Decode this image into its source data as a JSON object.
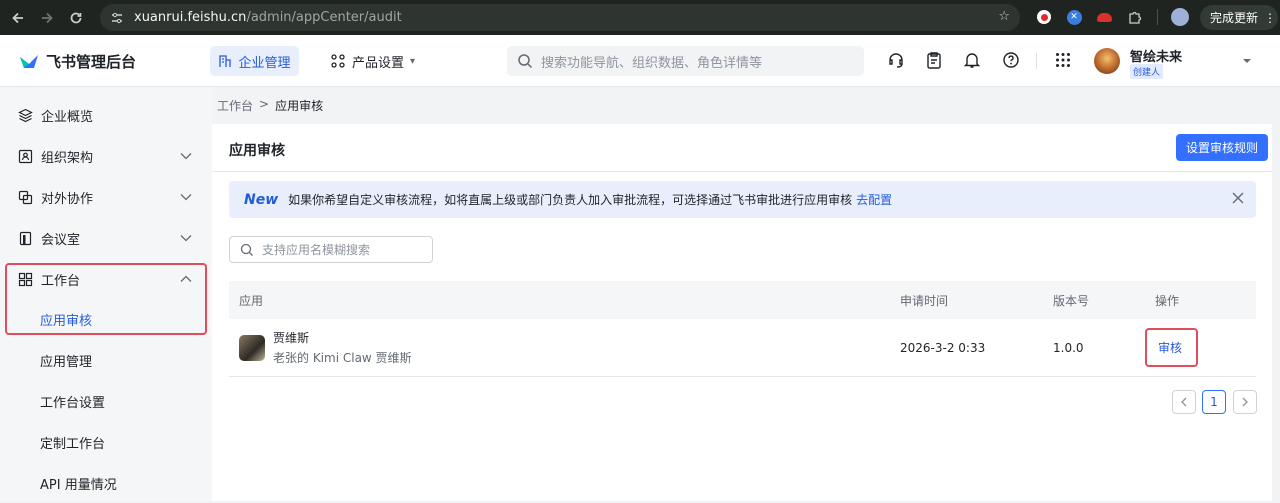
{
  "browser": {
    "url_host": "xuanrui.feishu.cn",
    "url_path": "/admin/appCenter/audit",
    "update_label": "完成更新"
  },
  "header": {
    "logo_text": "飞书管理后台",
    "tab_enterprise": "企业管理",
    "tab_product": "产品设置",
    "search_placeholder": "搜索功能导航、组织数据、角色详情等",
    "user_name": "智绘未来",
    "user_badge": "创建人"
  },
  "sidebar": {
    "items": [
      {
        "label": "企业概览"
      },
      {
        "label": "组织架构"
      },
      {
        "label": "对外协作"
      },
      {
        "label": "会议室"
      },
      {
        "label": "工作台"
      },
      {
        "label": "应用审核"
      },
      {
        "label": "应用管理"
      },
      {
        "label": "工作台设置"
      },
      {
        "label": "定制工作台"
      },
      {
        "label": "API 用量情况"
      }
    ]
  },
  "breadcrumb": {
    "parent": "工作台",
    "sep": ">",
    "current": "应用审核"
  },
  "panel": {
    "title": "应用审核",
    "primary_button": "设置审核规则",
    "notice_badge": "New",
    "notice_text": "如果你希望自定义审核流程，如将直属上级或部门负责人加入审批流程，可选择通过飞书审批进行应用审核",
    "notice_link": "去配置",
    "search_placeholder": "支持应用名模糊搜索"
  },
  "table": {
    "headers": [
      "应用",
      "申请时间",
      "版本号",
      "操作"
    ],
    "rows": [
      {
        "name": "贾维斯",
        "desc": "老张的 Kimi Claw 贾维斯",
        "time": "2026-3-2 0:33",
        "version": "1.0.0",
        "action": "审核"
      }
    ]
  },
  "pagination": {
    "current": "1"
  }
}
